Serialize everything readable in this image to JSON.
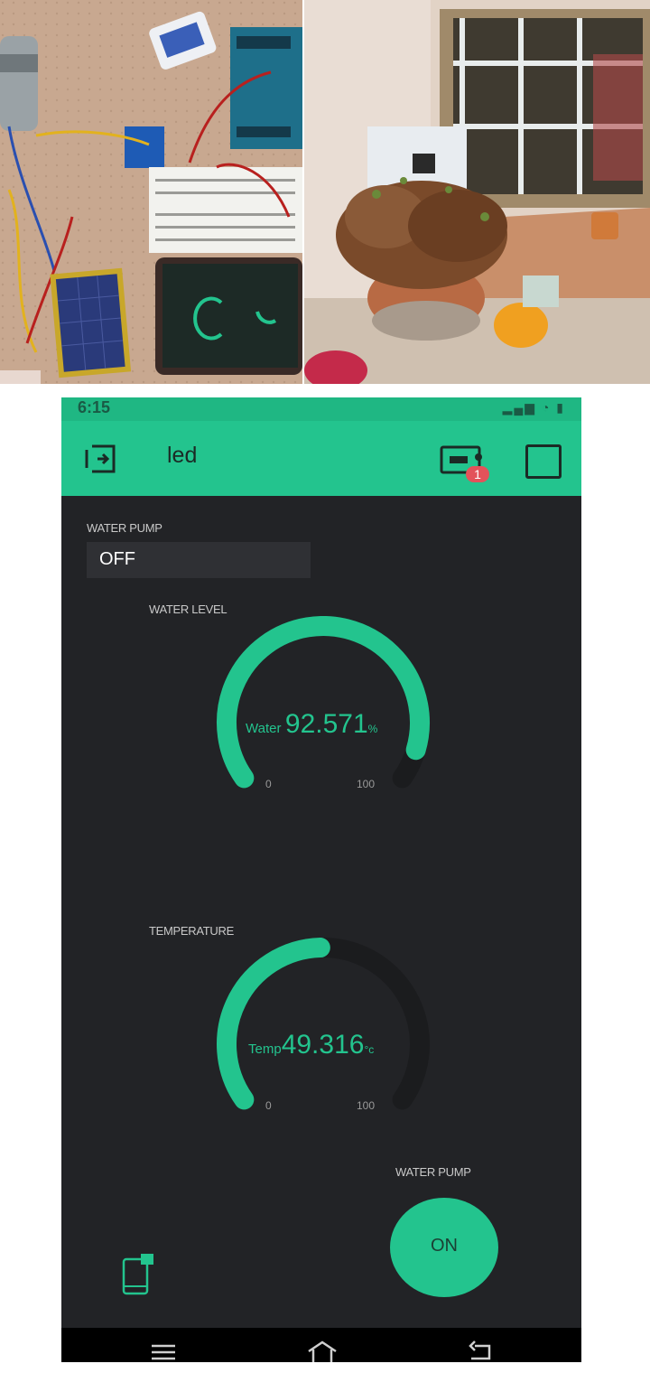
{
  "statusbar": {
    "time": "6:15",
    "icons": [
      "signal-icon",
      "wifi-icon",
      "battery-icon"
    ]
  },
  "appbar": {
    "title": "led",
    "notification_count": "1"
  },
  "pump_display": {
    "label": "WATER PUMP",
    "value": "OFF"
  },
  "water_gauge": {
    "label": "WATER LEVEL",
    "prefix": "Water",
    "value": "92.571",
    "unit": "%",
    "min": "0",
    "max": "100",
    "fraction": 0.9257
  },
  "temp_gauge": {
    "label": "TEMPERATURE",
    "prefix": "Temp",
    "value": "49.316",
    "unit": "°c",
    "min": "0",
    "max": "100",
    "fraction": 0.4932
  },
  "pump_button": {
    "label": "WATER PUMP",
    "value": "ON"
  },
  "colors": {
    "accent": "#23c48e",
    "background": "#222326",
    "track": "#1b1c1e",
    "notification": "#e3525a"
  }
}
